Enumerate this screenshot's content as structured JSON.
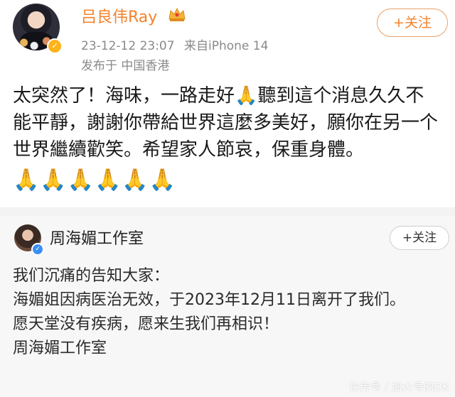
{
  "post_main": {
    "author": "吕良伟Ray",
    "timestamp": "23-12-12 23:07",
    "source": "来自iPhone 14",
    "location": "发布于 中国香港",
    "follow_label": "+关注",
    "body": "太突然了！海味，一路走好🙏聽到這个消息久久不能平靜，謝謝你帶給世界這麼多美好，願你在另一个世界繼續歡笑。希望家人節哀，保重身體。",
    "prayers": "🙏🙏🙏🙏🙏🙏"
  },
  "post_quoted": {
    "author": "周海媚工作室",
    "follow_label": "+关注",
    "lines": [
      "我们沉痛的告知大家：",
      "海媚姐因病医治无效，于2023年12月11日离开了我们。",
      "愿天堂没有疾病，愿来生我们再相识！",
      "周海媚工作室"
    ]
  },
  "watermark": "快传号 / 加大号的DK",
  "colors": {
    "accent": "#f4822b",
    "meta": "#8a8a8a",
    "quoted_bg": "#f7f7f7"
  },
  "icons": [
    "avatar-verified-badge",
    "crown-icon",
    "plus-icon",
    "pray-emoji"
  ]
}
